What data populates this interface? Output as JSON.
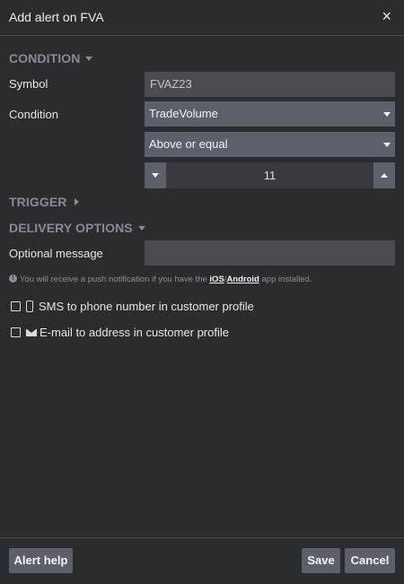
{
  "dialog": {
    "title": "Add alert on FVA",
    "close_glyph": "×"
  },
  "condition_section": {
    "heading": "CONDITION",
    "symbol_label": "Symbol",
    "symbol_value": "FVAZ23",
    "condition_label": "Condition",
    "condition_value": "TradeVolume",
    "operator_value": "Above or equal",
    "threshold_value": "11"
  },
  "trigger_section": {
    "heading": "TRIGGER"
  },
  "delivery_section": {
    "heading": "DELIVERY OPTIONS",
    "message_label": "Optional message",
    "message_value": "",
    "info_prefix": "You will receive a push notification if you have the ",
    "ios_link": "iOS",
    "separator": "/",
    "android_link": "Android",
    "info_suffix": " app installed.",
    "sms_label": "SMS to phone number in customer profile",
    "email_label": "E-mail to address in customer profile",
    "sms_checked": false,
    "email_checked": false
  },
  "footer": {
    "help_label": "Alert help",
    "save_label": "Save",
    "cancel_label": "Cancel"
  },
  "icons": [
    "close-icon",
    "caret-down-icon",
    "caret-right-icon",
    "chevron-down-icon",
    "chevron-up-icon",
    "info-icon",
    "phone-icon",
    "envelope-icon"
  ],
  "colors": {
    "background": "#2b2c30",
    "button": "#5b6069",
    "input": "#4a4c52",
    "section_heading": "#868b94"
  }
}
